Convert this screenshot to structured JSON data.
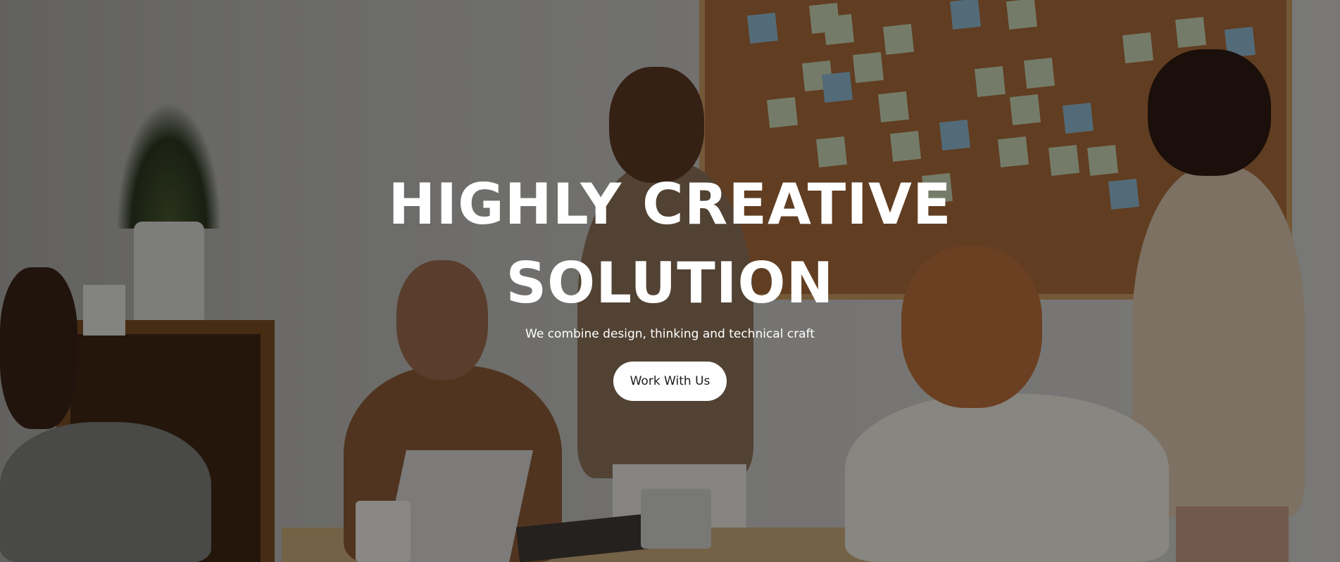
{
  "hero": {
    "title_line1": "HIGHLY CREATIVE",
    "title_line2": "SOLUTION",
    "subtitle": "We combine design, thinking and technical craft",
    "cta_label": "Work With Us",
    "overlay_color": "#000000",
    "text_color": "#ffffff",
    "button_bg": "#ffffff"
  }
}
